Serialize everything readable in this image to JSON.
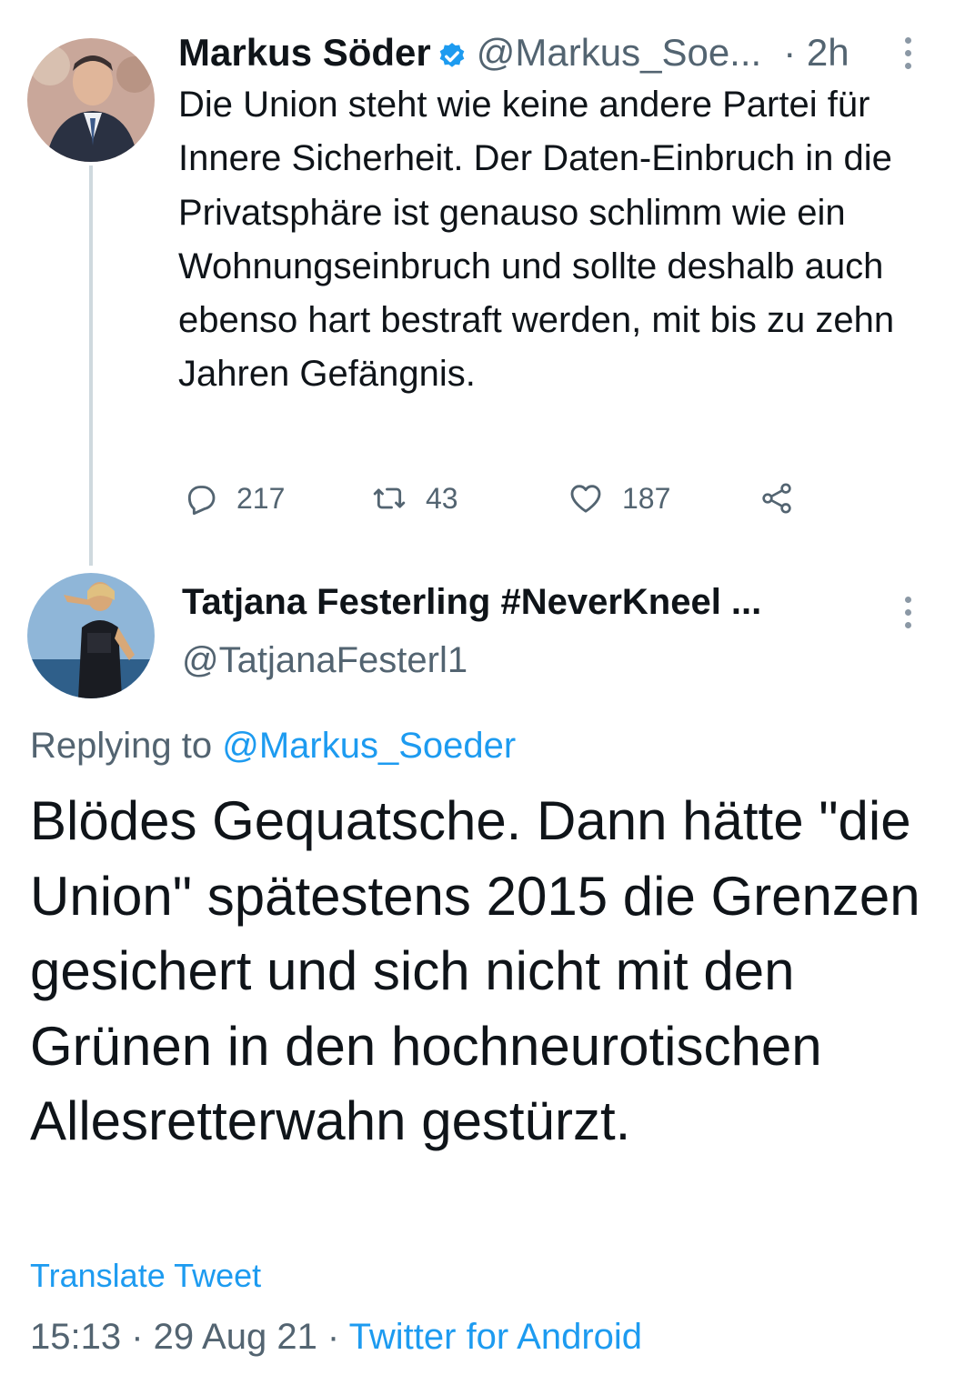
{
  "tweet1": {
    "author_name": "Markus Söder",
    "handle": "@Markus_Soe...",
    "time": "· 2h",
    "text": "Die Union steht wie keine andere Partei für Innere Sicherheit. Der Daten-Einbruch in die Privatsphäre ist genauso schlimm wie ein Wohnungseinbruch und sollte deshalb auch ebenso hart bestraft werden, mit bis zu zehn Jahren Gefängnis.",
    "replies": "217",
    "retweets": "43",
    "likes": "187"
  },
  "tweet2": {
    "author_name": "Tatjana Festerling #NeverKneel ...",
    "handle": "@TatjanaFesterl1",
    "replying_prefix": "Replying to",
    "replying_to": "@Markus_Soeder",
    "text": "Blödes Gequatsche. Dann hätte \"die Union\" spätestens 2015 die Grenzen gesichert und sich nicht mit den Grünen in den hochneurotischen Allesretterwahn gestürzt.",
    "translate_label": "Translate Tweet",
    "timestamp": "15:13 · 29 Aug 21 · ",
    "source": "Twitter for Android"
  },
  "colors": {
    "accent": "#1d9bf0",
    "secondary_text": "#536471",
    "primary_text": "#0f1419",
    "thread_line": "#cfd9de"
  },
  "icons": [
    "verified-badge-icon",
    "more-options-icon",
    "reply-icon",
    "retweet-icon",
    "like-icon",
    "share-icon"
  ]
}
